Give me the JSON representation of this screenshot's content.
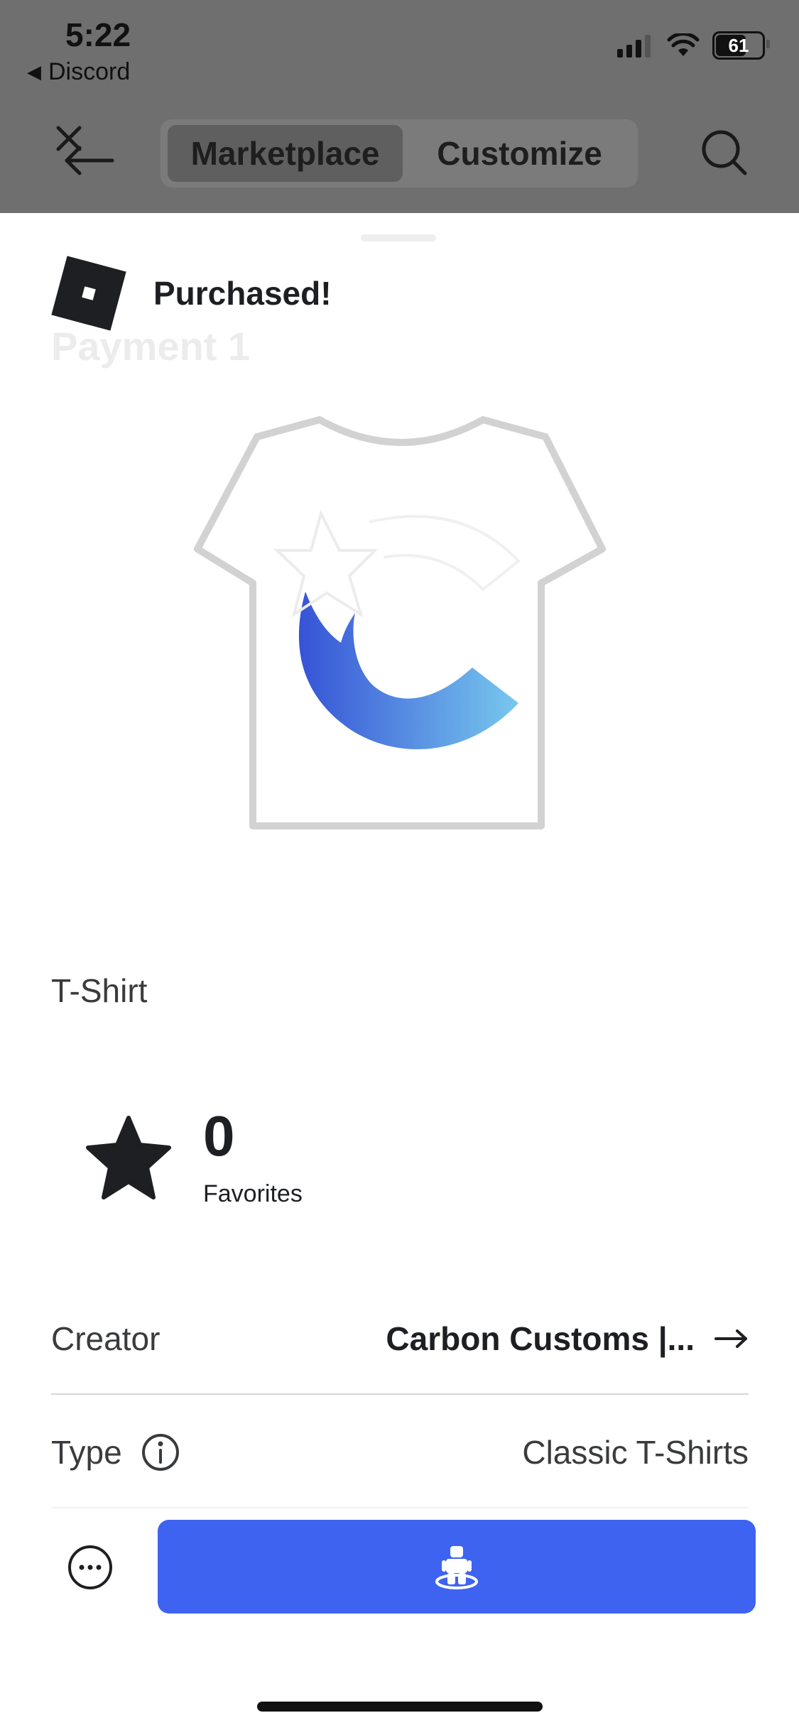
{
  "status_bar": {
    "time": "5:22",
    "back_app": "Discord",
    "battery": "61"
  },
  "toolbar": {
    "tabs": [
      {
        "label": "Marketplace",
        "active": true
      },
      {
        "label": "Customize",
        "active": false
      }
    ]
  },
  "toast": {
    "message": "Purchased!"
  },
  "item": {
    "title": "Payment 1",
    "category": "T-Shirt",
    "favorites_count": "0",
    "favorites_label": "Favorites"
  },
  "details": {
    "creator_label": "Creator",
    "creator_value": "Carbon Customs |...",
    "type_label": "Type",
    "type_value": "Classic T-Shirts"
  },
  "colors": {
    "accent": "#3d63f0",
    "overlay": "#6f6f6f",
    "text_primary": "#1d1f22",
    "text_secondary": "#393b3d"
  },
  "icons": [
    "close-back-icon",
    "search-icon",
    "roblox-logo-icon",
    "star-icon",
    "arrow-right-icon",
    "info-icon",
    "more-icon",
    "avatar-try-on-icon"
  ]
}
